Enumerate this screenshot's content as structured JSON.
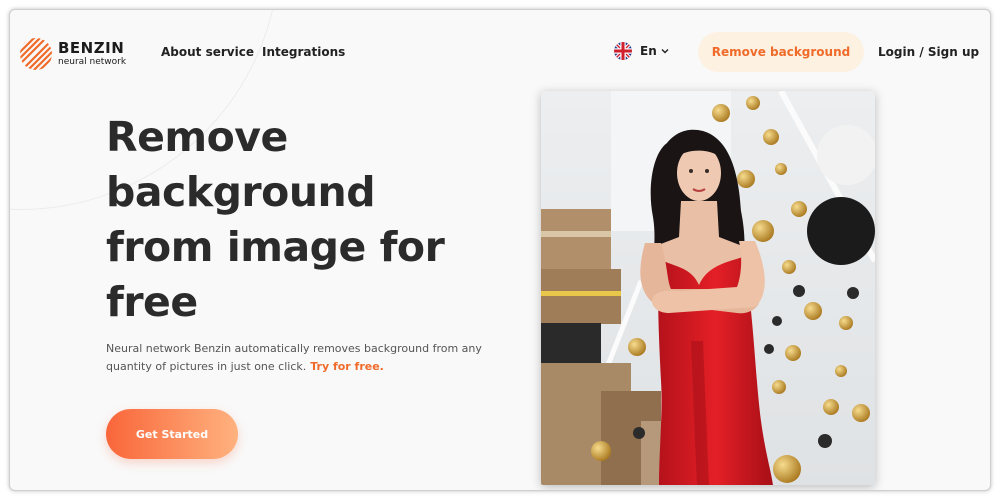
{
  "brand": {
    "name": "BENZIN",
    "subtitle": "neural network"
  },
  "nav": {
    "about": "About service",
    "integrations": "Integrations"
  },
  "language": {
    "label": "En"
  },
  "header": {
    "remove_bg_label": "Remove background",
    "login_label": "Login / Sign up"
  },
  "hero": {
    "title": "Remove background from image for free",
    "description": "Neural network Benzin automatically removes background from any quantity of pictures in just one click.",
    "try_link": "Try for free.",
    "cta_label": "Get Started"
  },
  "colors": {
    "accent": "#f06b2a",
    "accent_light": "#fdf2e2",
    "text": "#2b2b2b"
  },
  "icons": {
    "language": "uk-flag-icon",
    "dropdown": "chevron-down-icon",
    "logo": "benzin-logo-icon"
  }
}
